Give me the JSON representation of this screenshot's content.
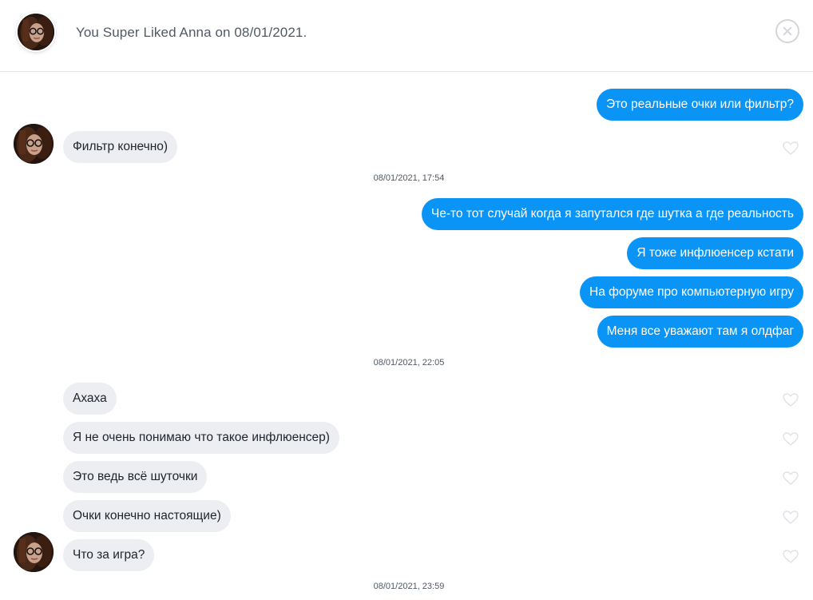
{
  "header": {
    "text": "You Super Liked Anna on 08/01/2021."
  },
  "messages": [
    {
      "text": "Это реальные очки или фильтр?"
    },
    {
      "text": "Фильтр конечно)"
    },
    {
      "text": "Че-то тот случай когда я запутался где шутка а где реальность"
    },
    {
      "text": "Я тоже инфлюенсер кстати"
    },
    {
      "text": "На форуме про компьютерную игру"
    },
    {
      "text": "Меня все уважают там я олдфаг"
    },
    {
      "text": "Ахаха"
    },
    {
      "text": "Я не очень понимаю что такое инфлюенсер)"
    },
    {
      "text": "Это ведь всё шуточки"
    },
    {
      "text": "Очки конечно настоящие)"
    },
    {
      "text": "Что за игра?"
    }
  ],
  "timestamps": [
    "08/01/2021, 17:54",
    "08/01/2021, 22:05",
    "08/01/2021, 23:59"
  ],
  "colors": {
    "sent_bubble": "#0a95f6",
    "received_bubble": "#eceef1",
    "text": "#21262e"
  }
}
